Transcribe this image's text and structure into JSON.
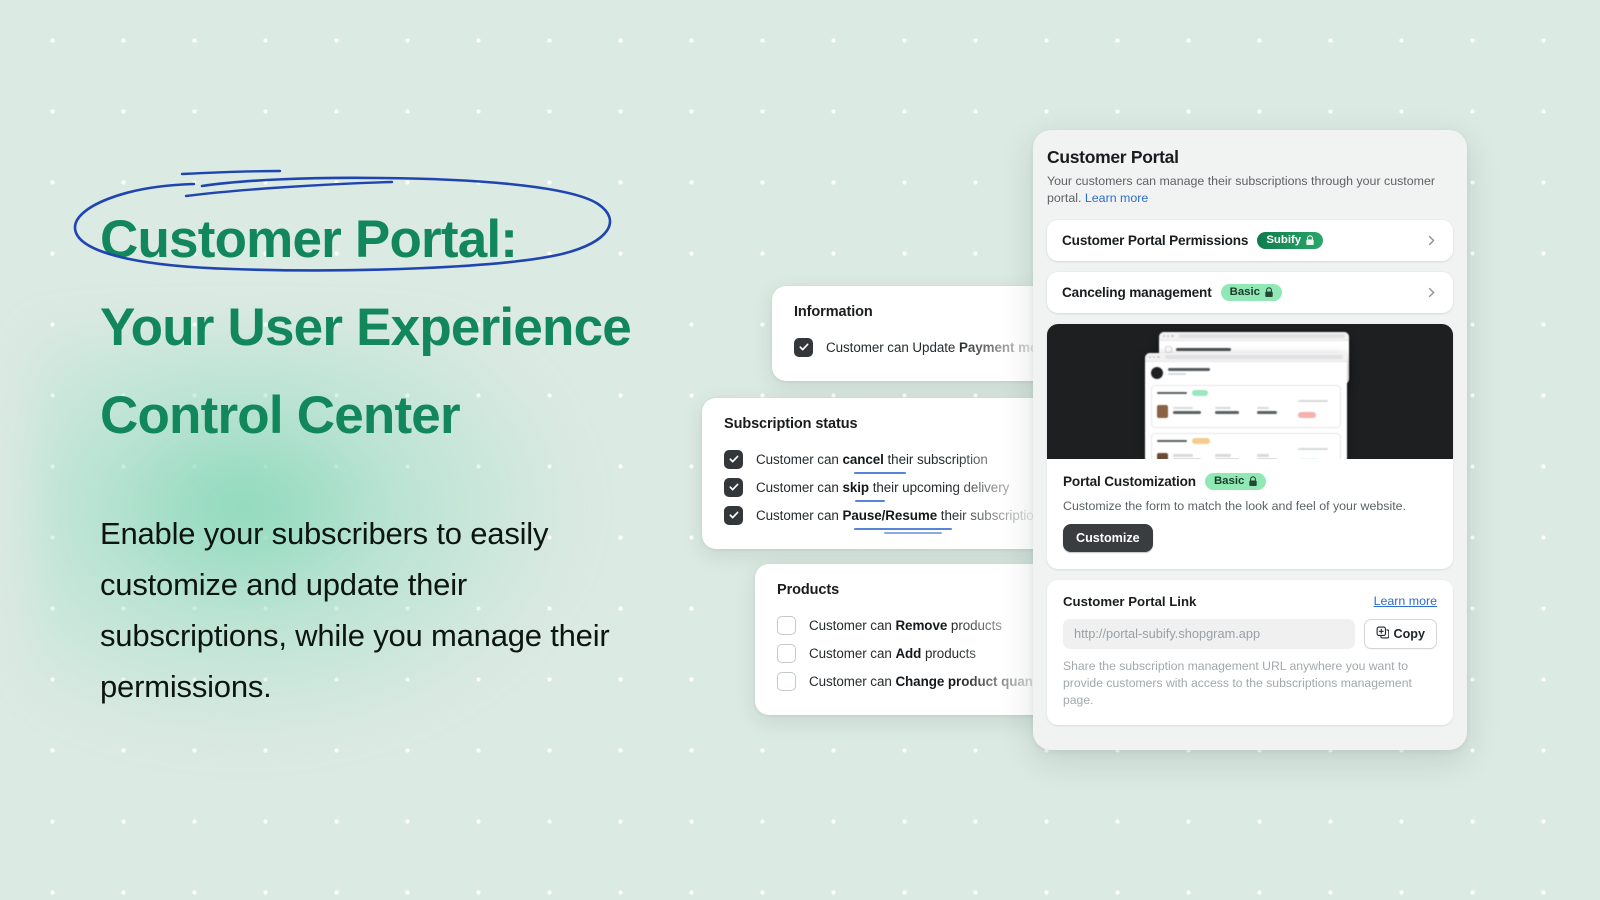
{
  "hero": {
    "headline_lines": [
      "Customer Portal:",
      "Your User Experience",
      "Control Center"
    ],
    "body": "Enable your subscribers to easily customize and update their subscriptions, while you manage their permissions.",
    "accent_color": "#12875b",
    "circle_color": "#1f45b0",
    "background_color": "#dbeae3"
  },
  "floating_cards": [
    {
      "title": "Information",
      "items": [
        {
          "prefix": "Customer can Update ",
          "bold": "Payment method",
          "suffix": "",
          "checked": true,
          "underline": false
        }
      ]
    },
    {
      "title": "Subscription status",
      "items": [
        {
          "prefix": "Customer can ",
          "bold": "cancel",
          "suffix": " their subscription",
          "checked": true,
          "underline": true
        },
        {
          "prefix": "Customer can ",
          "bold": "skip",
          "suffix": " their upcoming delivery",
          "checked": true,
          "underline": true
        },
        {
          "prefix": "Customer can ",
          "bold": "Pause/Resume",
          "suffix": " their subscription renew",
          "checked": true,
          "underline": true
        }
      ]
    },
    {
      "title": "Products",
      "items": [
        {
          "prefix": "Customer can ",
          "bold": "Remove",
          "suffix": " products",
          "checked": false,
          "underline": false
        },
        {
          "prefix": "Customer can ",
          "bold": "Add",
          "suffix": " products",
          "checked": false,
          "underline": false
        },
        {
          "prefix": "Customer can ",
          "bold": "Change product quantity",
          "suffix": "",
          "checked": false,
          "underline": false
        }
      ]
    }
  ],
  "portal": {
    "title": "Customer Portal",
    "subtitle": "Your customers can manage their subscriptions through your customer portal.",
    "subtitle_link": "Learn more",
    "rows": [
      {
        "title": "Customer Portal Permissions",
        "badge": "Subify",
        "badge_type": "subify"
      },
      {
        "title": "Canceling management",
        "badge": "Basic",
        "badge_type": "basic"
      }
    ],
    "customization": {
      "title": "Portal Customization",
      "badge": "Basic",
      "badge_type": "basic",
      "description": "Customize the form to match the look and feel of your website.",
      "button": "Customize"
    },
    "link_section": {
      "title": "Customer Portal Link",
      "learn_more": "Learn more",
      "url_placeholder": "http://portal-subify.shopgram.app",
      "copy_button": "Copy",
      "note": "Share the subscription management URL anywhere you want to provide customers with access to the subscriptions management page."
    }
  },
  "colors": {
    "brand_green": "#12875b",
    "badge_subify_start": "#0f7a4c",
    "badge_subify_end": "#2aa86a",
    "badge_basic": "#90e8b4",
    "link_blue": "#2c6ecb",
    "dark_button": "#393d40",
    "underline_blue": "#3b6fd4"
  }
}
